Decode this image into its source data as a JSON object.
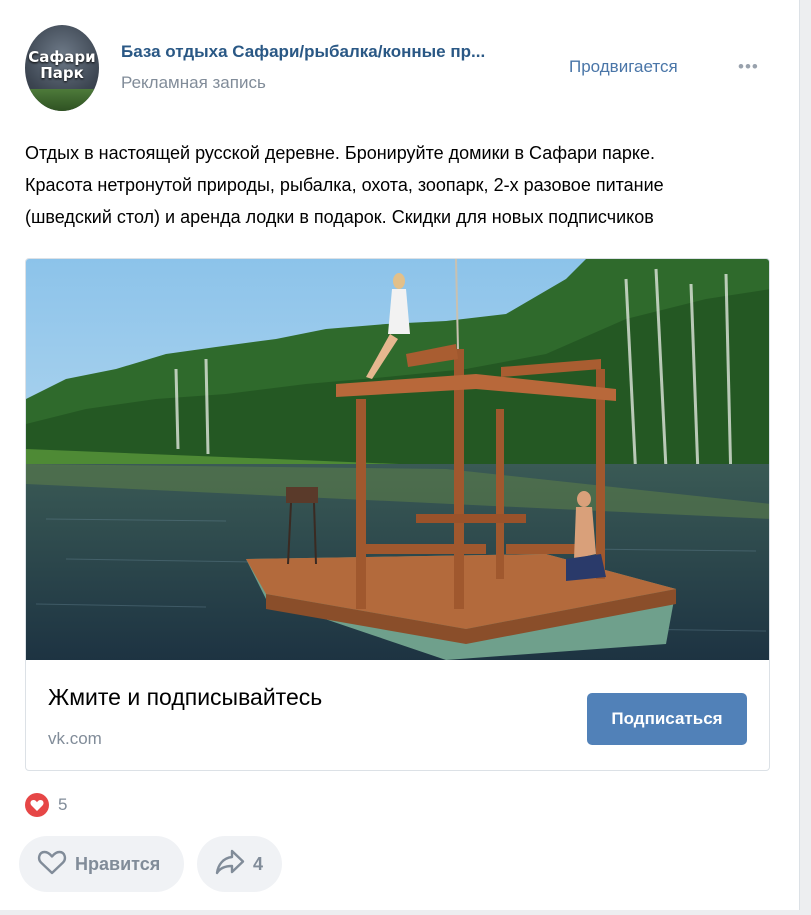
{
  "post": {
    "author": "База отдыха Сафари/рыбалка/конные пр...",
    "subtitle": "Рекламная запись",
    "promote_label": "Продвигается",
    "more_label": "•••",
    "avatar_text_line1": "Сафари",
    "avatar_text_line2": "Парк",
    "text_lines": [
      "Отдых в настоящей русской деревне. Бронируйте домики в Сафари парке.",
      "Красота нетронутой природы, рыбалка, охота, зоопарк, 2-х разовое питание",
      "(шведский стол) и аренда лодки в подарок. Скидки для новых подписчиков"
    ]
  },
  "attachment": {
    "title": "Жмите и подписывайтесь",
    "domain": "vk.com",
    "button_label": "Подписаться",
    "image_icon": "photo-lake-raft"
  },
  "reactions": {
    "likes_count": "5",
    "like_label": "Нравится",
    "share_count": "4",
    "heart_icon": "heart-icon",
    "share_icon": "share-icon"
  },
  "colors": {
    "link": "#2a5885",
    "accent": "#5181b8",
    "muted": "#818c99",
    "heart": "#e64646"
  }
}
